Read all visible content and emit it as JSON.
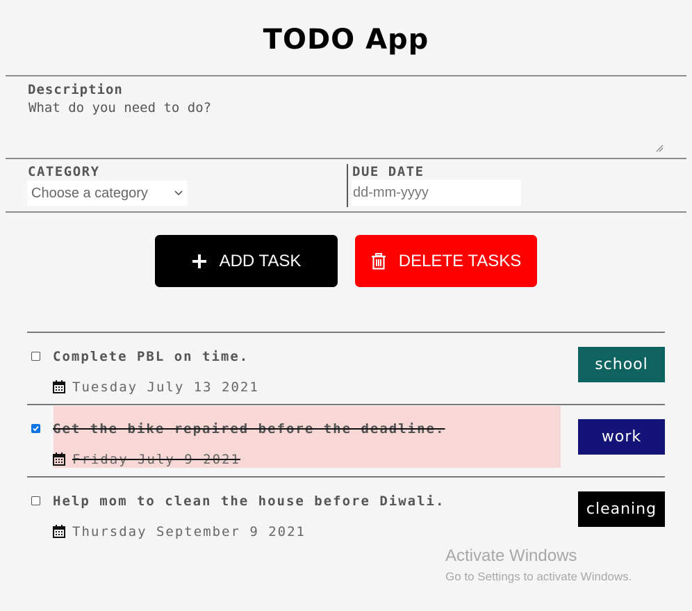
{
  "app": {
    "title": "TODO App"
  },
  "form": {
    "description_label": "Description",
    "description_placeholder": "What do you need to do?",
    "category_label": "CATEGORY",
    "category_selected": "Choose a category",
    "due_date_label": "DUE DATE",
    "due_date_placeholder": "dd-mm-yyyy"
  },
  "buttons": {
    "add_label": "ADD TASK",
    "add_icon": "plus-icon",
    "delete_label": "DELETE TASKS",
    "delete_icon": "trash-icon",
    "add_color": "#000000",
    "delete_color": "#ff0000"
  },
  "tasks": [
    {
      "text": "Complete PBL on time.",
      "date": "Tuesday July 13 2021",
      "category": "school",
      "tag_color": "#0e6360",
      "done": false
    },
    {
      "text": "Get the bike repaired before the deadline.",
      "date": "Friday July 9 2021",
      "category": "work",
      "tag_color": "#141478",
      "done": true
    },
    {
      "text": "Help mom to clean the house before Diwali.",
      "date": "Thursday September 9 2021",
      "category": "cleaning",
      "tag_color": "#000000",
      "done": false
    }
  ],
  "watermark": {
    "title": "Activate Windows",
    "subtitle": "Go to Settings to activate Windows."
  }
}
